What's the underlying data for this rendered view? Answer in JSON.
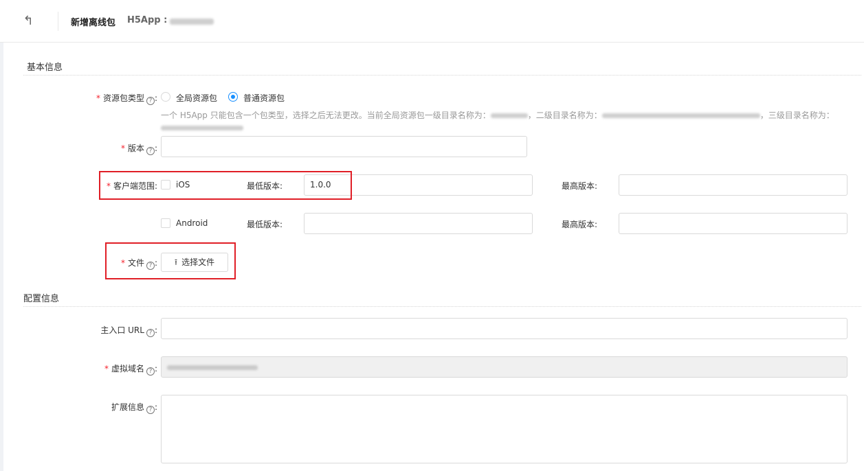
{
  "header": {
    "back_icon": "undo-arrow-icon",
    "title": "新增离线包",
    "app_label": "H5App :"
  },
  "sections": {
    "basic": "基本信息",
    "config": "配置信息"
  },
  "fields": {
    "package_type": {
      "label": "资源包类型",
      "options": [
        "全局资源包",
        "普通资源包"
      ],
      "selected": "普通资源包",
      "hint_prefix": "一个 H5App 只能包含一个包类型，选择之后无法更改。当前全局资源包一级目录名称为：",
      "hint_mid1": "，二级目录名称为：",
      "hint_mid2": "，三级目录名称为："
    },
    "version": {
      "label": "版本",
      "value": ""
    },
    "client_range": {
      "label": "客户端范围",
      "ios": {
        "label": "iOS",
        "min_label": "最低版本:",
        "min_value": "1.0.0",
        "max_label": "最高版本:",
        "max_value": ""
      },
      "android": {
        "label": "Android",
        "min_label": "最低版本:",
        "min_value": "",
        "max_label": "最高版本:",
        "max_value": ""
      }
    },
    "file": {
      "label": "文件",
      "button": "选择文件",
      "button_icon": "upload-icon"
    },
    "main_url": {
      "label": "主入口 URL",
      "value": ""
    },
    "virtual_domain": {
      "label": "虚拟域名"
    },
    "ext_info": {
      "label": "扩展信息",
      "value": ""
    }
  },
  "colors": {
    "required": "#f5222d",
    "accent": "#1890ff",
    "highlight_box": "#e01e26"
  }
}
